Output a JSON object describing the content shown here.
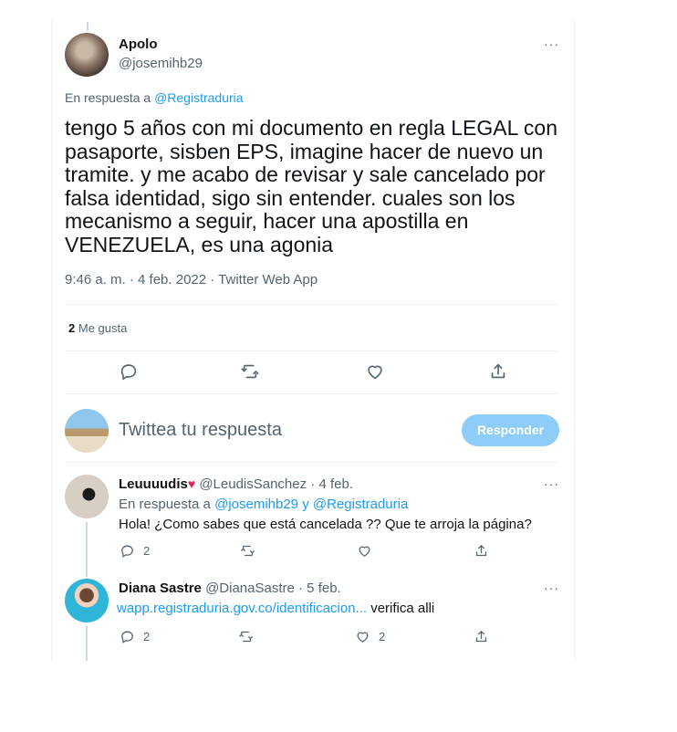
{
  "tweet": {
    "author_name": "Apolo",
    "author_handle": "@josemihb29",
    "reply_to_prefix": "En respuesta a",
    "reply_to_handle": "@Registraduria",
    "text": "tengo 5 años con mi documento en regla LEGAL con pasaporte, sisben EPS, imagine hacer de nuevo un tramite. y me acabo de revisar y sale cancelado por falsa identidad, sigo sin entender. cuales son los mecanismo a seguir, hacer una apostilla en VENEZUELA, es una agonia",
    "meta": "9:46 a. m. · 4 feb. 2022 · Twitter Web App",
    "likes_count": "2",
    "likes_label": "Me gusta",
    "more": "···"
  },
  "composer": {
    "placeholder": "Twittea tu respuesta",
    "button_label": "Responder"
  },
  "replies": [
    {
      "name": "Leuuuudis",
      "name_emoji": "♥",
      "handle": "@LeudisSanchez",
      "date": "· 4 feb.",
      "reply_prefix": "En respuesta a",
      "reply_handle_1": "@josemihb29",
      "reply_conj": "y",
      "reply_handle_2": "@Registraduria",
      "text": "Hola! ¿Como sabes que está cancelada ?? Que te arroja la página?",
      "reply_count": "2",
      "retweet_count": "",
      "like_count": "",
      "more": "···"
    },
    {
      "name": "Diana Sastre",
      "handle": "@DianaSastre",
      "date": "· 5 feb.",
      "link": "wapp.registraduria.gov.co/identificacion...",
      "text": "verifica alli",
      "reply_count": "2",
      "retweet_count": "",
      "like_count": "2",
      "more": "···"
    }
  ],
  "icons": [
    "reply-icon",
    "retweet-icon",
    "like-icon",
    "share-icon",
    "more-icon"
  ],
  "colors": {
    "accent": "#1d9bf0",
    "button_disabled": "#8ecdf7",
    "muted": "#536471",
    "heart": "#e0245e"
  }
}
